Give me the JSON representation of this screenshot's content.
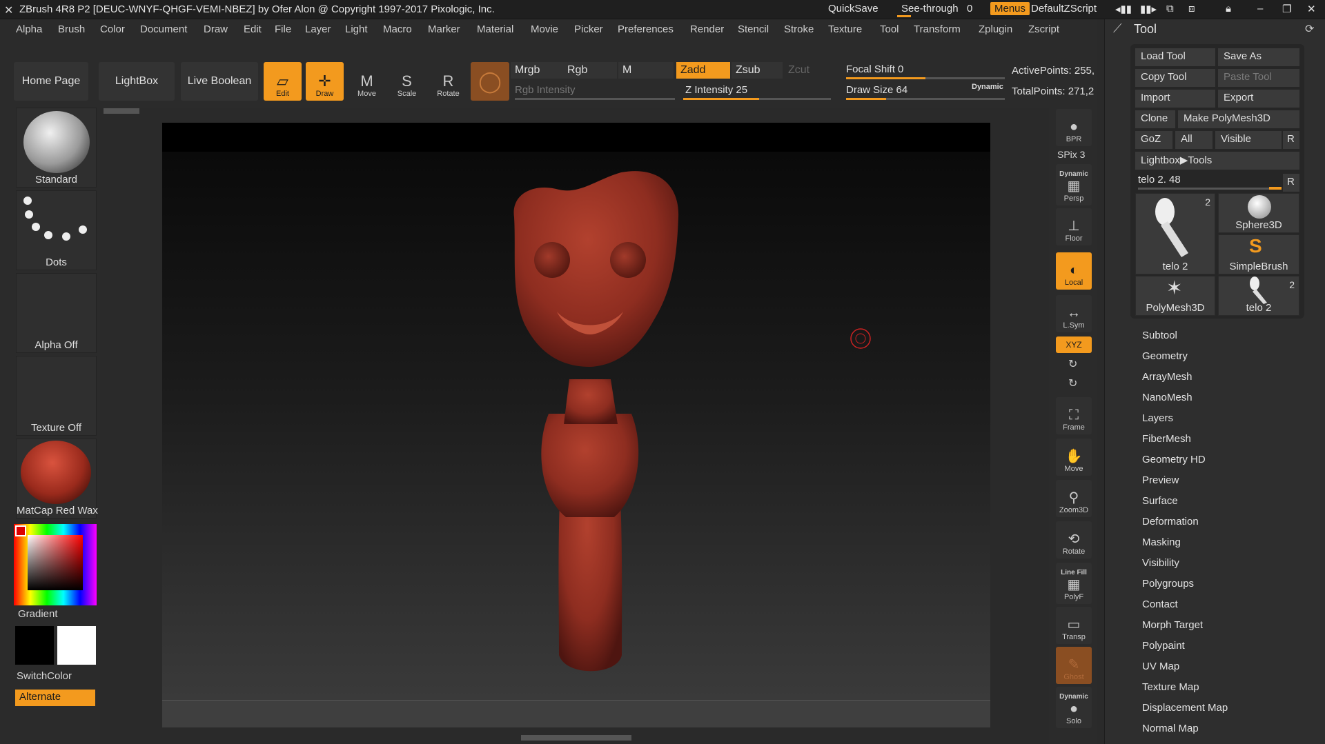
{
  "titlebar": {
    "title": "ZBrush 4R8 P2 [DEUC-WNYF-QHGF-VEMI-NBEZ] by Ofer Alon @ Copyright 1997-2017 Pixologic, Inc.",
    "quicksave": "QuickSave",
    "see_through_label": "See-through",
    "see_through_value": "0",
    "menus": "Menus",
    "script": "DefaultZScript"
  },
  "menubar": [
    "Alpha",
    "Brush",
    "Color",
    "Document",
    "Draw",
    "Edit",
    "File",
    "Layer",
    "Light",
    "Macro",
    "Marker",
    "Material",
    "Movie",
    "Picker",
    "Preferences",
    "Render",
    "Stencil",
    "Stroke",
    "Texture",
    "Tool",
    "Transform",
    "Zplugin",
    "Zscript"
  ],
  "toolbar": {
    "home": "Home Page",
    "lightbox": "LightBox",
    "live_boolean": "Live Boolean",
    "edit": "Edit",
    "draw": "Draw",
    "move": "Move",
    "scale": "Scale",
    "rotate": "Rotate",
    "mrgb": "Mrgb",
    "rgb": "Rgb",
    "m": "M",
    "zadd": "Zadd",
    "zsub": "Zsub",
    "zcut": "Zcut",
    "rgb_intensity": "Rgb Intensity",
    "z_intensity": "Z Intensity 25",
    "focal_shift": "Focal Shift 0",
    "draw_size": "Draw Size 64",
    "dynamic": "Dynamic",
    "active_points": "ActivePoints: 255,",
    "total_points": "TotalPoints: 271,2"
  },
  "left": {
    "brush": "Standard",
    "stroke": "Dots",
    "alpha": "Alpha Off",
    "texture": "Texture Off",
    "material": "MatCap Red Wax",
    "gradient": "Gradient",
    "switch": "SwitchColor",
    "alternate": "Alternate"
  },
  "rightbar": {
    "bpr": "BPR",
    "spix": "SPix 3",
    "dynamic": "Dynamic",
    "persp": "Persp",
    "floor": "Floor",
    "local": "Local",
    "lsym": "L.Sym",
    "xyz": "XYZ",
    "frame": "Frame",
    "move": "Move",
    "zoom": "Zoom3D",
    "rotate": "Rotate",
    "linefill": "Line Fill",
    "polyf": "PolyF",
    "transp": "Transp",
    "ghost": "Ghost",
    "dynamic2": "Dynamic",
    "solo": "Solo"
  },
  "toolpanel": {
    "header": "Tool",
    "load": "Load Tool",
    "save_as": "Save As",
    "copy": "Copy Tool",
    "paste": "Paste Tool",
    "import": "Import",
    "export": "Export",
    "clone": "Clone",
    "make_poly": "Make PolyMesh3D",
    "goz": "GoZ",
    "all": "All",
    "visible": "Visible",
    "r": "R",
    "lightbox_tools": "Lightbox▶Tools",
    "current": "telo 2. 48",
    "r2": "R",
    "tiles": [
      {
        "label": "telo 2",
        "count": "2"
      },
      {
        "label": "Sphere3D",
        "count": ""
      },
      {
        "label": "SimpleBrush",
        "count": ""
      },
      {
        "label": "PolyMesh3D",
        "count": ""
      },
      {
        "label": "telo 2",
        "count": "2"
      }
    ],
    "sections": [
      "Subtool",
      "Geometry",
      "ArrayMesh",
      "NanoMesh",
      "Layers",
      "FiberMesh",
      "Geometry HD",
      "Preview",
      "Surface",
      "Deformation",
      "Masking",
      "Visibility",
      "Polygroups",
      "Contact",
      "Morph Target",
      "Polypaint",
      "UV Map",
      "Texture Map",
      "Displacement Map",
      "Normal Map"
    ]
  },
  "colors": {
    "accent": "#f39a1e",
    "model": "#8e2d20"
  }
}
